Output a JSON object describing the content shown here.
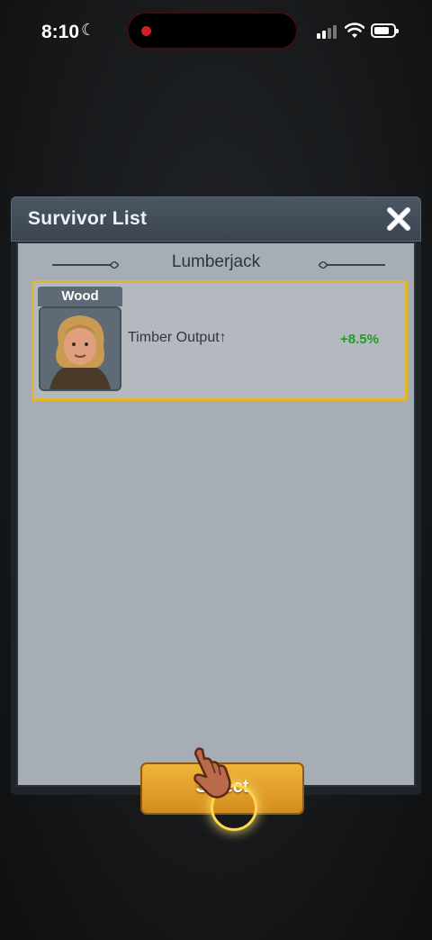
{
  "status_bar": {
    "time": "8:10"
  },
  "dialog": {
    "title": "Survivor List",
    "section_title": "Lumberjack",
    "survivor": {
      "tag": "Wood",
      "stat_label": "Timber Output↑",
      "stat_value": "+8.5%"
    },
    "select_label": "Select"
  },
  "colors": {
    "accent_gold": "#e2b52a",
    "positive_green": "#1f9a2b",
    "button_orange": "#e2a02c"
  },
  "icons": [
    "moon-icon",
    "signal-icon",
    "wifi-icon",
    "battery-icon",
    "close-icon",
    "pointer-hand-icon"
  ]
}
